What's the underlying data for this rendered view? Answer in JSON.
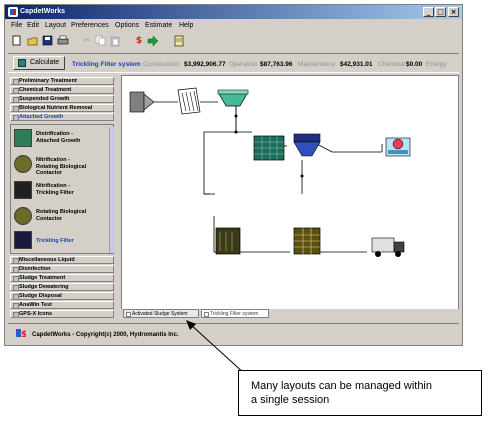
{
  "window": {
    "title": "CapdetWorks",
    "controls": [
      "_",
      "□",
      "×"
    ]
  },
  "menu": [
    "File",
    "Edit",
    "Layout",
    "Preferences",
    "Options",
    "Estimate",
    "Help"
  ],
  "toolbar": {
    "icons": [
      "new-document-icon",
      "open-folder-icon",
      "save-disk-icon",
      "print-icon",
      "cut-icon",
      "copy-icon",
      "paste-icon",
      "dollar-icon",
      "arrow-right-icon",
      "notepad-icon"
    ],
    "dollar_symbol": "$",
    "dollar_color": "#d21b1b",
    "arrow_color": "#1a9a3a"
  },
  "costs": {
    "calculate_label": "Calculate",
    "system_name": "Trickling Filter system",
    "construction_label": "Construction",
    "construction_value": "$3,992,906.77",
    "operation_label": "Operation",
    "operation_value": "$87,763.96",
    "maintenance_label": "Maintenance",
    "maintenance_value": "$42,931.01",
    "chemical_label": "Chemical",
    "chemical_value": "$0.00",
    "energy_label": "Energy"
  },
  "categories_top": [
    "Preliminary Treatment",
    "Chemical Treatment",
    "Suspended Growth",
    "Biological Nutrient Removal",
    "Attached Growth"
  ],
  "active_category": "Attached Growth",
  "sub_items": [
    {
      "label": "Distrification - Attached Growth",
      "lines": [
        "Distrification -",
        "Attached Growth"
      ],
      "icon": "NO3",
      "icon_color": "#2e7d5a"
    },
    {
      "label": "Nitrification - Rotating Biological Contactor",
      "lines": [
        "Nitrification -",
        "Rotating Biological",
        "Contactor"
      ],
      "icon": "NH3",
      "icon_color": "#6b6b2a"
    },
    {
      "label": "Nitrification - Trickling Filter",
      "lines": [
        "Nitrification -",
        "Trickling Filter"
      ],
      "icon": "NH3",
      "icon_color": "#202020"
    },
    {
      "label": "Rotating Biological Contactor",
      "lines": [
        "Rotating Biological",
        "Contactor"
      ],
      "icon": "",
      "icon_color": "#6b6b2a"
    },
    {
      "label": "Trickling Filter",
      "lines": [
        "Trickling Filter"
      ],
      "icon": "",
      "icon_color": "#1a1a40"
    }
  ],
  "categories_bottom": [
    "Miscellaneous Liquid",
    "Disinfection",
    "Sludge Treatment",
    "Sludge Dewatering",
    "Sludge Disposal",
    "AnaWin Test",
    "GPS-X Icons"
  ],
  "tabs": [
    {
      "label": "Activated Sludge System",
      "active": true
    },
    {
      "label": "Trickling Filter system",
      "active": false
    }
  ],
  "status": {
    "text": "CapdetWorks - Copyright(c) 2000, Hydromantis Inc."
  },
  "callout": {
    "text": "Many layouts can be managed within\na single session"
  },
  "flowsheet_units": [
    "influent-pump",
    "screening-unit",
    "primary-clarifier",
    "aeration-basin",
    "secondary-clarifier",
    "disinfection-unit",
    "digester-unit",
    "sludge-dewatering-unit",
    "sludge-truck"
  ]
}
